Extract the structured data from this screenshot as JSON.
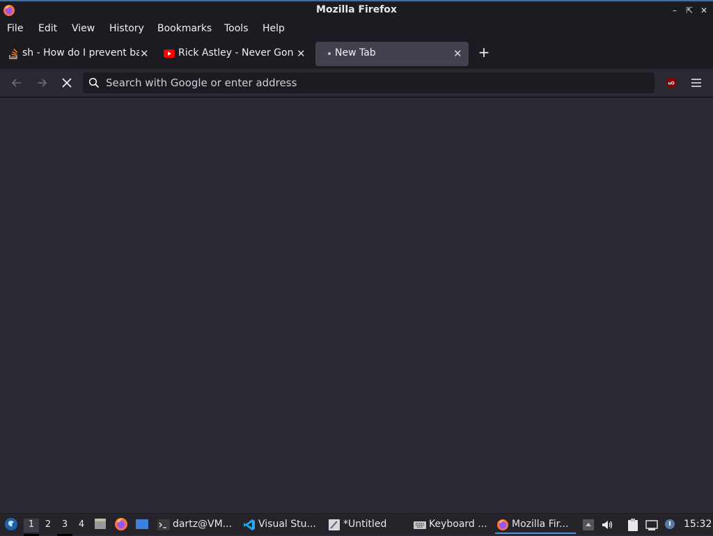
{
  "window": {
    "title": "Mozilla Firefox"
  },
  "menu": {
    "items": [
      "File",
      "Edit",
      "View",
      "History",
      "Bookmarks",
      "Tools",
      "Help"
    ]
  },
  "tabs": [
    {
      "label": "sh - How do I prevent ba",
      "icon": "stackoverflow-icon",
      "active": false
    },
    {
      "label": "Rick Astley - Never Gonn",
      "icon": "youtube-icon",
      "active": false
    },
    {
      "label": "New Tab",
      "icon": "loading-dot",
      "active": true
    }
  ],
  "navbar": {
    "url_placeholder": "Search with Google or enter address"
  },
  "taskbar": {
    "workspaces": [
      "1",
      "2",
      "3",
      "4"
    ],
    "active_workspace": "1",
    "tasks": [
      {
        "label": "dartz@VM...",
        "icon": "terminal-icon"
      },
      {
        "label": "Visual Stu...",
        "icon": "vscode-icon"
      },
      {
        "label": "*Untitled",
        "icon": "text-editor-icon"
      },
      {
        "label": "Keyboard ...",
        "icon": "keyboard-icon"
      },
      {
        "label": "Mozilla Fir...",
        "icon": "firefox-icon",
        "active": true
      }
    ],
    "clock": "15:32"
  },
  "colors": {
    "chrome_bg": "#1c1b22",
    "content_bg": "#2b2a33",
    "active_tab": "#42414d",
    "accent": "#5294e2"
  }
}
